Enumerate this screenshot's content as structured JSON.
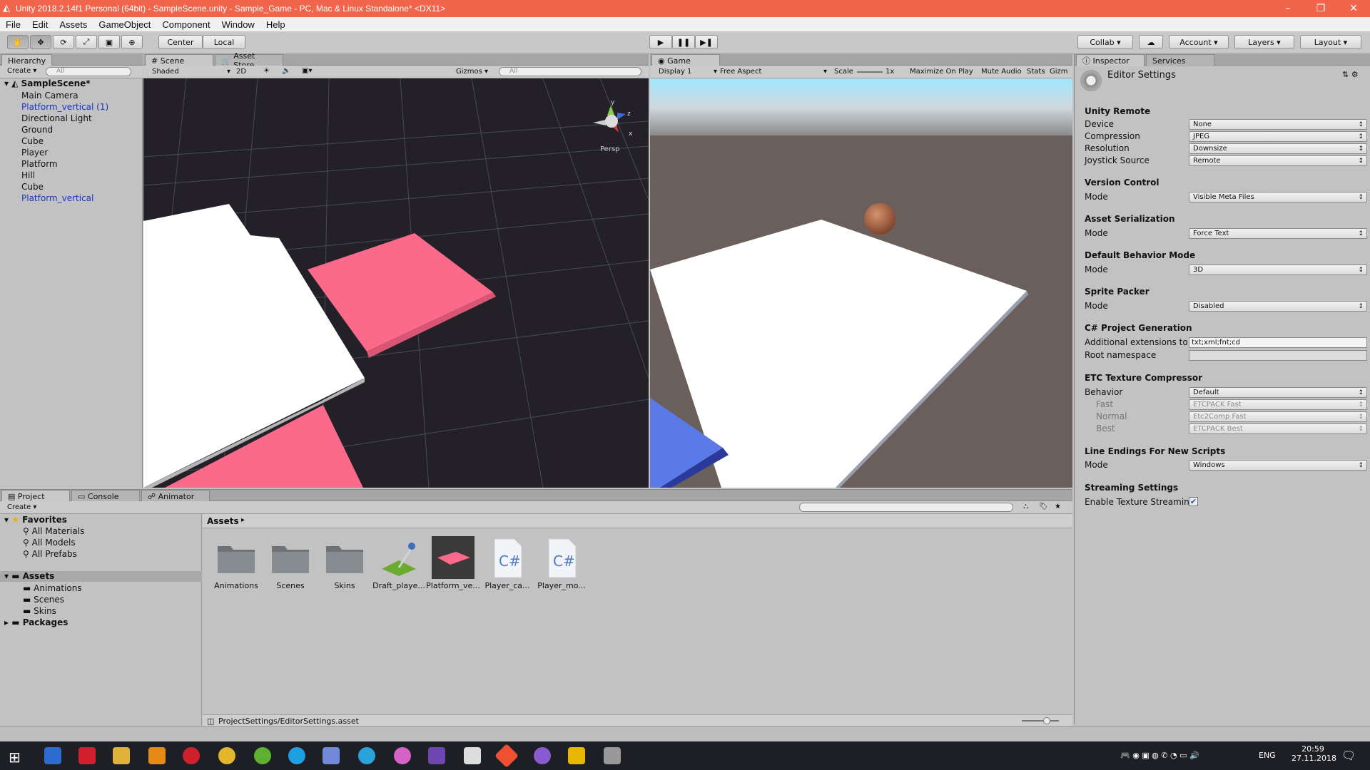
{
  "window": {
    "title": "Unity 2018.2.14f1 Personal (64bit) - SampleScene.unity - Sample_Game - PC, Mac & Linux Standalone* <DX11>",
    "minimize": "–",
    "maximize": "❐",
    "close": "✕"
  },
  "menu": [
    "File",
    "Edit",
    "Assets",
    "GameObject",
    "Component",
    "Window",
    "Help"
  ],
  "toolbar": {
    "center": "Center",
    "local": "Local",
    "collab": "Collab ▾",
    "account": "Account",
    "layers": "Layers",
    "layout": "Layout"
  },
  "hierarchy": {
    "tab": "Hierarchy",
    "create": "Create ▾",
    "search_placeholder": "All",
    "scene": "SampleScene*",
    "items": [
      {
        "label": "Main Camera",
        "prefab": false
      },
      {
        "label": "Platform_vertical (1)",
        "prefab": true
      },
      {
        "label": "Directional Light",
        "prefab": false
      },
      {
        "label": "Ground",
        "prefab": false
      },
      {
        "label": "Cube",
        "prefab": false
      },
      {
        "label": "Player",
        "prefab": false
      },
      {
        "label": "Platform",
        "prefab": false
      },
      {
        "label": "Hill",
        "prefab": false
      },
      {
        "label": "Cube",
        "prefab": false
      },
      {
        "label": "Platform_vertical",
        "prefab": true
      }
    ]
  },
  "scene_view": {
    "tab": "Scene",
    "tab2": "Asset Store",
    "shaded": "Shaded",
    "mode2d": "2D",
    "gizmos": "Gizmos ▾",
    "search_placeholder": "All",
    "persp": "Persp",
    "axis_y": "y",
    "axis_x": "x",
    "axis_z": "z"
  },
  "game_view": {
    "tab": "Game",
    "display": "Display 1",
    "aspect": "Free Aspect",
    "scale_label": "Scale",
    "scale_value": "1x",
    "maximize": "Maximize On Play",
    "mute": "Mute Audio",
    "stats": "Stats",
    "gizmos": "Gizm"
  },
  "inspector": {
    "tab": "Inspector",
    "tab2": "Services",
    "title": "Editor Settings",
    "sections": {
      "unity_remote": "Unity Remote",
      "version_control": "Version Control",
      "asset_serialization": "Asset Serialization",
      "default_behavior": "Default Behavior Mode",
      "sprite_packer": "Sprite Packer",
      "csharp": "C# Project Generation",
      "etc": "ETC Texture Compressor",
      "line_endings": "Line Endings For New Scripts",
      "streaming": "Streaming Settings"
    },
    "fields": {
      "device": {
        "label": "Device",
        "value": "None"
      },
      "compression": {
        "label": "Compression",
        "value": "JPEG"
      },
      "resolution": {
        "label": "Resolution",
        "value": "Downsize"
      },
      "joystick": {
        "label": "Joystick Source",
        "value": "Remote"
      },
      "vc_mode": {
        "label": "Mode",
        "value": "Visible Meta Files"
      },
      "as_mode": {
        "label": "Mode",
        "value": "Force Text"
      },
      "db_mode": {
        "label": "Mode",
        "value": "3D"
      },
      "sp_mode": {
        "label": "Mode",
        "value": "Disabled"
      },
      "add_ext": {
        "label": "Additional extensions to i",
        "value": "txt;xml;fnt;cd"
      },
      "root_ns": {
        "label": "Root namespace",
        "value": ""
      },
      "behavior": {
        "label": "Behavior",
        "value": "Default"
      },
      "fast": {
        "label": "Fast",
        "value": "ETCPACK Fast"
      },
      "normal": {
        "label": "Normal",
        "value": "Etc2Comp Fast"
      },
      "best": {
        "label": "Best",
        "value": "ETCPACK Best"
      },
      "le_mode": {
        "label": "Mode",
        "value": "Windows"
      },
      "texture_streaming": {
        "label": "Enable Texture Streamin",
        "checked": true
      }
    }
  },
  "project": {
    "tabs": [
      "Project",
      "Console",
      "Animator"
    ],
    "create": "Create ▾",
    "favorites": "Favorites",
    "fav_items": [
      "All Materials",
      "All Models",
      "All Prefabs"
    ],
    "assets_root": "Assets",
    "asset_folders": [
      "Animations",
      "Scenes",
      "Skins"
    ],
    "packages": "Packages",
    "breadcrumb": "Assets",
    "assets": [
      {
        "label": "Animations",
        "kind": "folder"
      },
      {
        "label": "Scenes",
        "kind": "folder"
      },
      {
        "label": "Skins",
        "kind": "folder"
      },
      {
        "label": "Draft_playe...",
        "kind": "material"
      },
      {
        "label": "Platform_ve...",
        "kind": "prefab"
      },
      {
        "label": "Player_ca...",
        "kind": "script"
      },
      {
        "label": "Player_mo...",
        "kind": "script"
      }
    ],
    "status_path": "ProjectSettings/EditorSettings.asset"
  },
  "taskbar": {
    "time": "20:59",
    "date": "27.11.2018",
    "lang": "ENG"
  },
  "colors": {
    "titlebar": "#f0654b",
    "pink": "#fb6a8a",
    "blue_link": "#1a35c7"
  }
}
